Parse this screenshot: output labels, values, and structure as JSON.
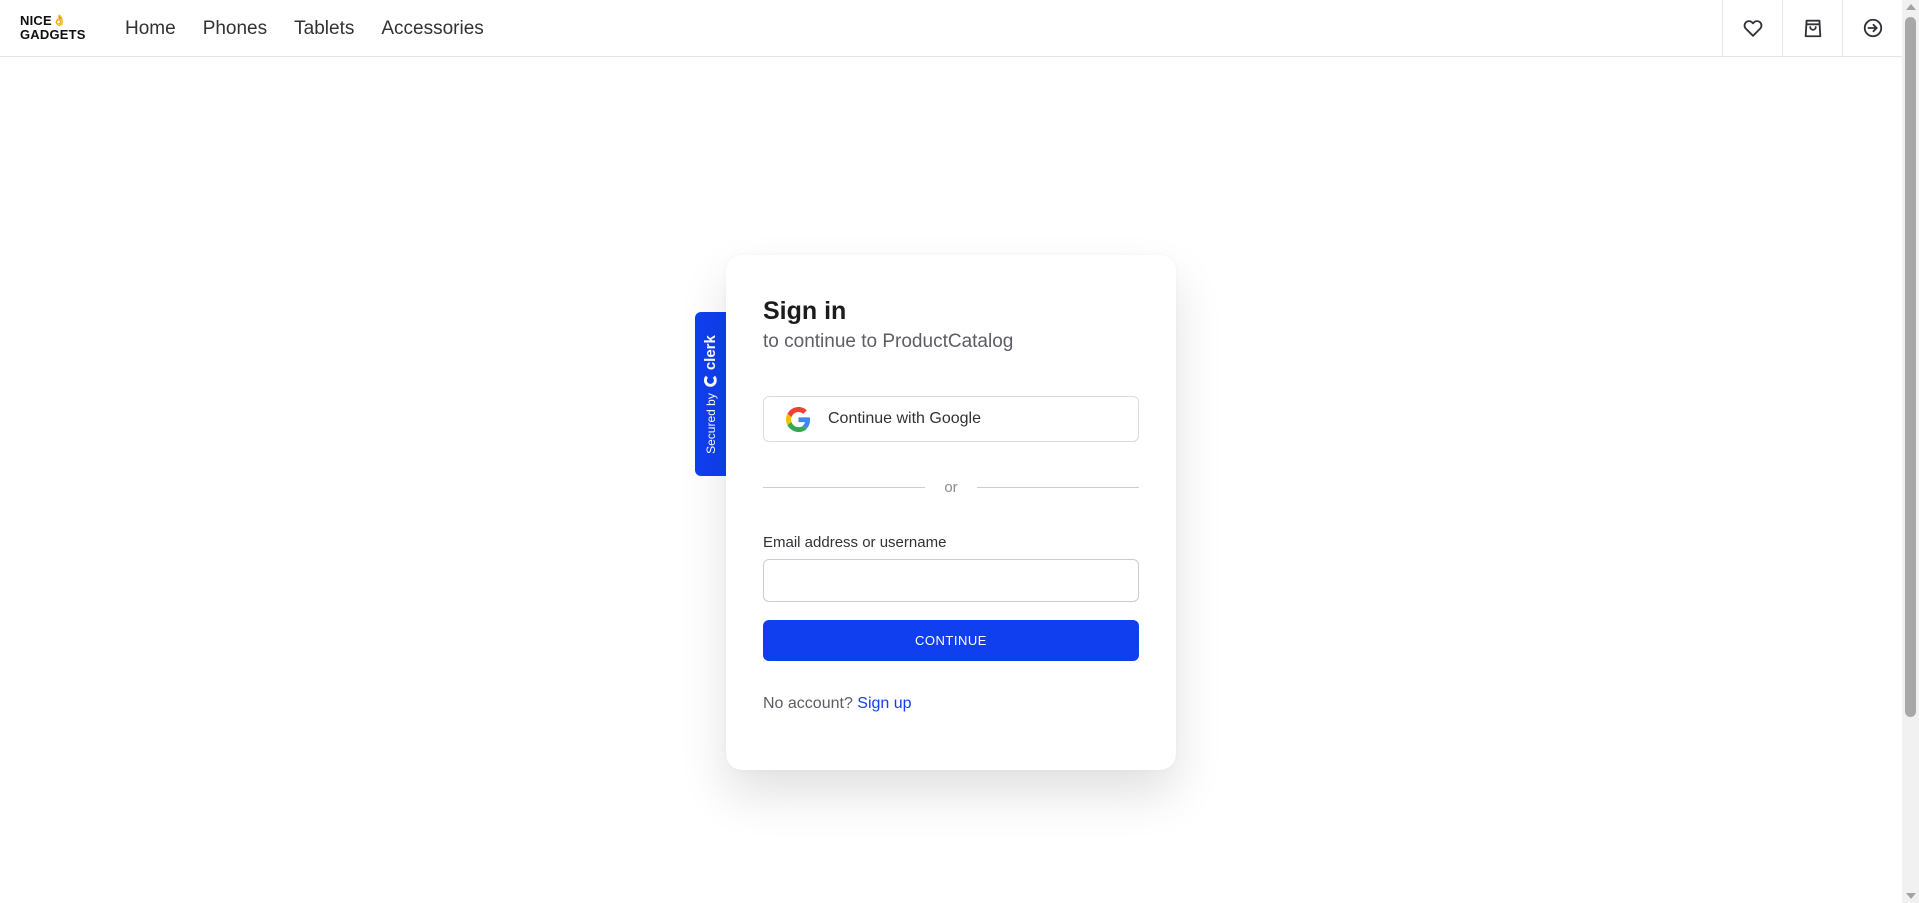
{
  "header": {
    "logo": {
      "line1": "NICE",
      "line2": "GADGETS",
      "mark": "👌"
    },
    "nav": [
      {
        "label": "Home"
      },
      {
        "label": "Phones"
      },
      {
        "label": "Tablets"
      },
      {
        "label": "Accessories"
      }
    ],
    "icons": [
      "heart-icon",
      "shopping-bag-icon",
      "sign-in-icon"
    ]
  },
  "secured": {
    "text": "Secured by",
    "brand": "clerk"
  },
  "signin": {
    "title": "Sign in",
    "subtitle": "to continue to ProductCatalog",
    "google_label": "Continue with Google",
    "divider": "or",
    "email_label": "Email address or username",
    "email_value": "",
    "continue_label": "CONTINUE",
    "no_account": "No account?",
    "signup_label": "Sign up"
  },
  "colors": {
    "accent": "#103fef",
    "text": "#313237",
    "border": "#e2e6e9"
  }
}
